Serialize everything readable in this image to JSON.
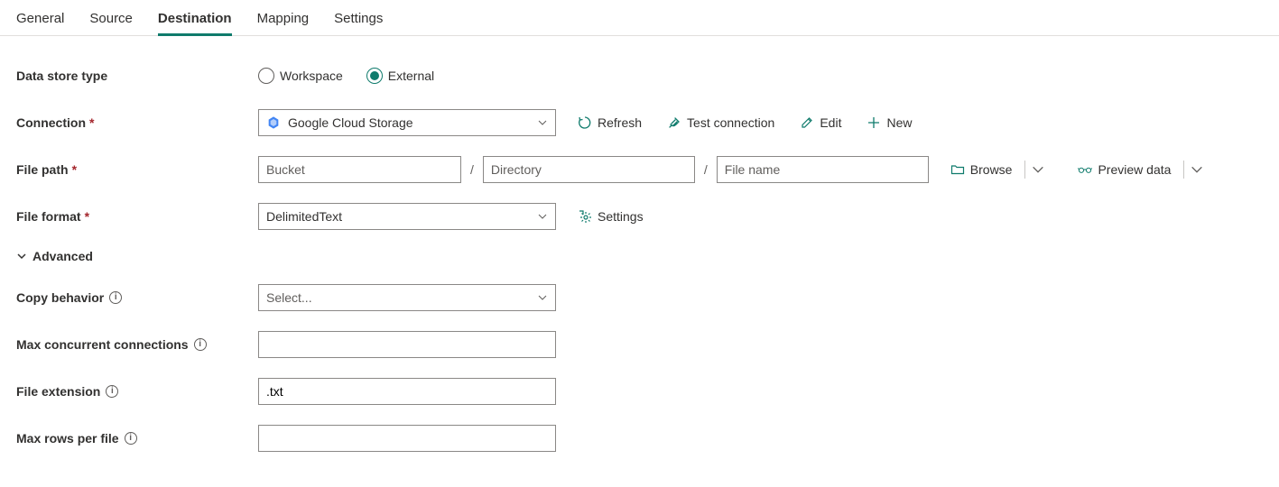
{
  "tabs": {
    "general": "General",
    "source": "Source",
    "destination": "Destination",
    "mapping": "Mapping",
    "settings": "Settings",
    "active": "destination"
  },
  "labels": {
    "data_store_type": "Data store type",
    "connection": "Connection",
    "file_path": "File path",
    "file_format": "File format",
    "advanced": "Advanced",
    "copy_behavior": "Copy behavior",
    "max_concurrent": "Max concurrent connections",
    "file_extension": "File extension",
    "max_rows": "Max rows per file"
  },
  "data_store_type": {
    "options": {
      "workspace": "Workspace",
      "external": "External"
    },
    "selected": "external"
  },
  "connection": {
    "value": "Google Cloud Storage",
    "actions": {
      "refresh": "Refresh",
      "test": "Test connection",
      "edit": "Edit",
      "new": "New"
    }
  },
  "file_path": {
    "bucket_ph": "Bucket",
    "directory_ph": "Directory",
    "filename_ph": "File name",
    "bucket_val": "",
    "directory_val": "",
    "filename_val": "",
    "browse": "Browse",
    "preview": "Preview data"
  },
  "file_format": {
    "value": "DelimitedText",
    "settings": "Settings"
  },
  "advanced": {
    "copy_behavior_ph": "Select...",
    "copy_behavior_val": "",
    "max_concurrent_val": "",
    "file_extension_val": ".txt",
    "max_rows_val": ""
  }
}
